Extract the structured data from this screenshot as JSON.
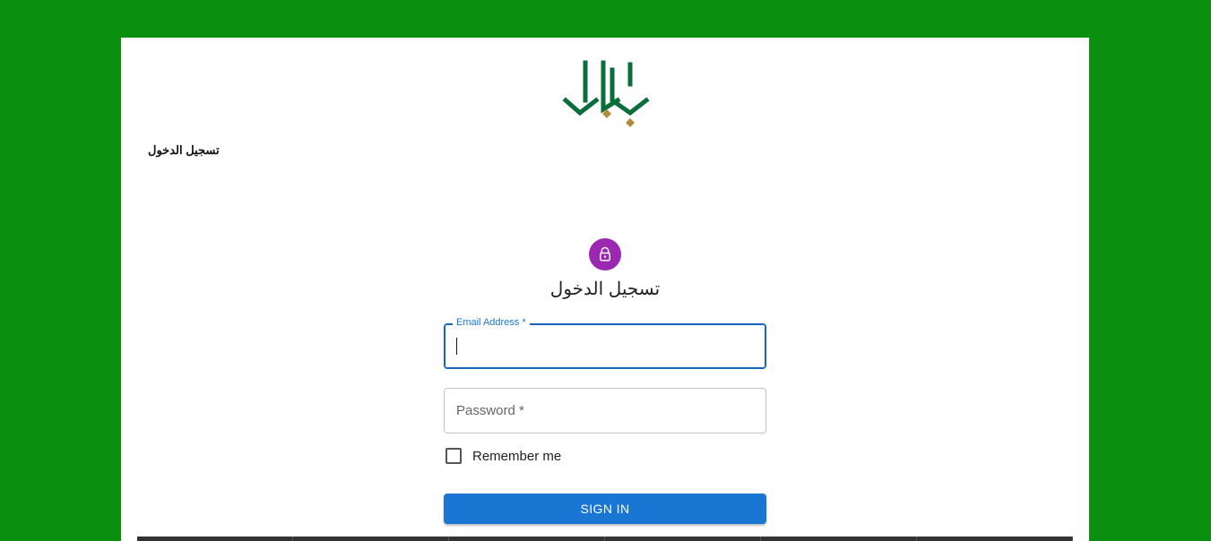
{
  "header": {
    "logo_icon": "babel-arabic-logo",
    "page_heading": "تسجيل الدخول"
  },
  "login_form": {
    "avatar_icon": "lock-icon",
    "avatar_color": "#9c27b0",
    "title": "تسجيل الدخول",
    "email_label": "Email Address *",
    "email_value": "",
    "password_placeholder": "Password *",
    "remember_label": "Remember me",
    "remember_checked": false,
    "signin_label": "SIGN IN"
  },
  "colors": {
    "background": "#0b8f0e",
    "primary": "#1976d2",
    "logo_green": "#0a6e3a",
    "logo_gold": "#b38b3a"
  }
}
